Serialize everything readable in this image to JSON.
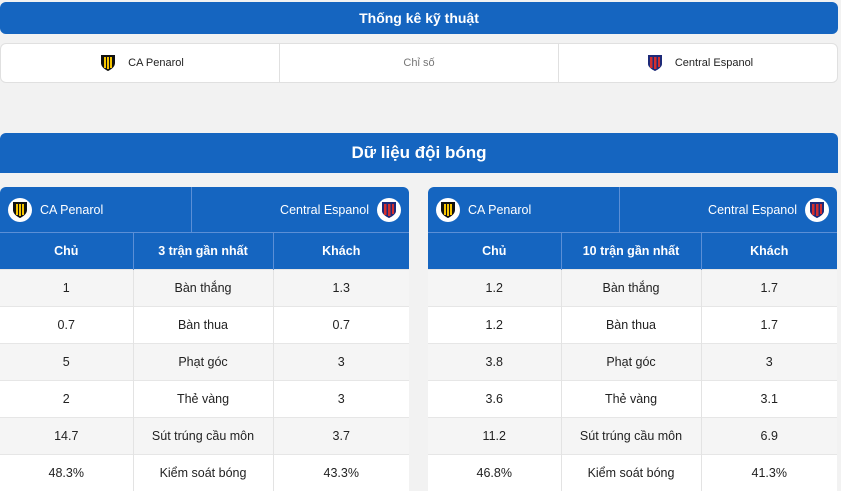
{
  "tech": {
    "title": "Thống kê kỹ thuật",
    "home_team": "CA Penarol",
    "middle_label": "Chỉ số",
    "away_team": "Central Espanol"
  },
  "data_section": {
    "title": "Dữ liệu đội bóng"
  },
  "panels": [
    {
      "home_team": "CA Penarol",
      "away_team": "Central Espanol",
      "headers": [
        "Chủ",
        "3 trận gần nhất",
        "Khách"
      ],
      "rows": [
        {
          "home": "1",
          "stat": "Bàn thắng",
          "away": "1.3"
        },
        {
          "home": "0.7",
          "stat": "Bàn thua",
          "away": "0.7"
        },
        {
          "home": "5",
          "stat": "Phạt góc",
          "away": "3"
        },
        {
          "home": "2",
          "stat": "Thẻ vàng",
          "away": "3"
        },
        {
          "home": "14.7",
          "stat": "Sút trúng cầu môn",
          "away": "3.7"
        },
        {
          "home": "48.3%",
          "stat": "Kiểm soát bóng",
          "away": "43.3%"
        }
      ]
    },
    {
      "home_team": "CA Penarol",
      "away_team": "Central Espanol",
      "headers": [
        "Chủ",
        "10 trận gần nhất",
        "Khách"
      ],
      "rows": [
        {
          "home": "1.2",
          "stat": "Bàn thắng",
          "away": "1.7"
        },
        {
          "home": "1.2",
          "stat": "Bàn thua",
          "away": "1.7"
        },
        {
          "home": "3.8",
          "stat": "Phạt góc",
          "away": "3"
        },
        {
          "home": "3.6",
          "stat": "Thẻ vàng",
          "away": "3.1"
        },
        {
          "home": "11.2",
          "stat": "Sút trúng cầu môn",
          "away": "6.9"
        },
        {
          "home": "46.8%",
          "stat": "Kiểm soát bóng",
          "away": "41.3%"
        }
      ]
    }
  ],
  "icons": {
    "home": "penarol-crest-icon",
    "away": "central-espanol-crest-icon"
  },
  "colors": {
    "primary": "#1565c0",
    "penarol_yellow": "#f5c400",
    "espanol_red": "#d32f2f",
    "espanol_blue": "#1e2a78"
  }
}
